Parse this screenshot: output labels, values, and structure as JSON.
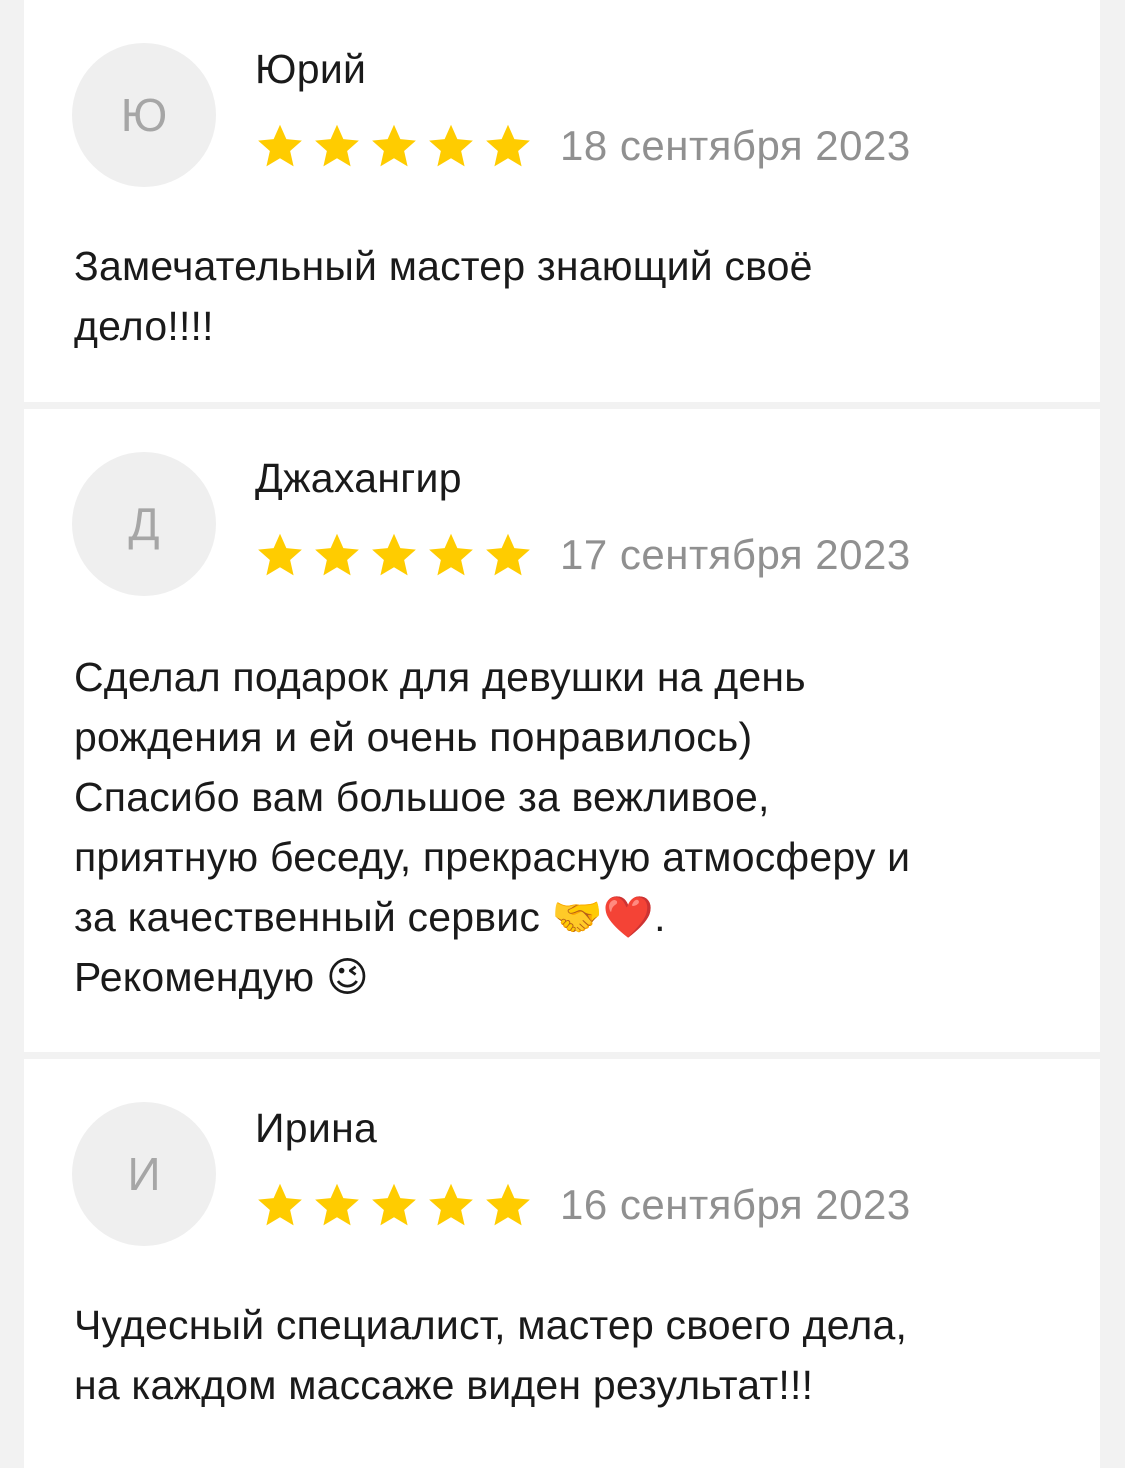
{
  "reviews": [
    {
      "avatar_letter": "Ю",
      "author": "Юрий",
      "rating": 5,
      "date": "18 сентября 2023",
      "text": "Замечательный мастер знающий своё\nдело!!!!"
    },
    {
      "avatar_letter": "Д",
      "author": "Джахангир",
      "rating": 5,
      "date": "17 сентября 2023",
      "text": "Сделал подарок для девушки на день\nрождения и ей очень понравилось)\nСпасибо вам большое за вежливое,\nприятную беседу, прекрасную атмосферу и\nза качественный сервис 🤝❤️.\nРекомендую 😉"
    },
    {
      "avatar_letter": "И",
      "author": "Ирина",
      "rating": 5,
      "date": "16 сентября 2023",
      "text": "Чудесный специалист, мастер своего дела,\nна каждом массаже виден результат!!!"
    }
  ],
  "colors": {
    "star": "#ffcc00",
    "date": "#909090",
    "avatar_bg": "#efefef",
    "avatar_letter": "#a6a6a6",
    "page_bg": "#f2f2f2",
    "card_bg": "#ffffff"
  }
}
